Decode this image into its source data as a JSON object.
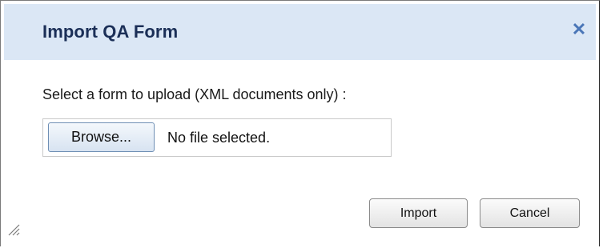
{
  "dialog": {
    "title": "Import QA Form",
    "close_icon": "close-icon",
    "close_glyph": "✕",
    "accent_color": "#4a76b7",
    "titlebar_color": "#dbe7f5"
  },
  "form": {
    "prompt": "Select a form to upload (XML documents only) :",
    "browse_label": "Browse...",
    "file_status": "No file selected."
  },
  "actions": {
    "import_label": "Import",
    "cancel_label": "Cancel"
  },
  "resize_grip_icon": "resize-grip-icon"
}
